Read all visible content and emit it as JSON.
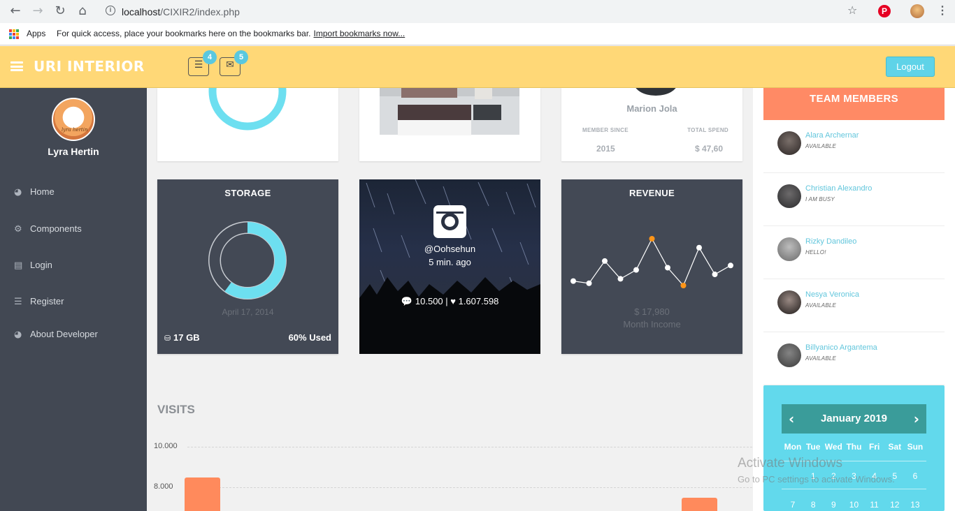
{
  "browser": {
    "url_host": "localhost",
    "url_path": "/CIXIR2/index.php",
    "apps_label": "Apps",
    "bookmarks_hint": "For quick access, place your bookmarks here on the bookmarks bar.",
    "import_link": "Import bookmarks now..."
  },
  "header": {
    "brand": "URI INTERIOR",
    "tasks_badge": "4",
    "mail_badge": "5",
    "logout_label": "Logout"
  },
  "sidebar": {
    "user_name": "Lyra Hertin",
    "avatar_caption": "lyra hertin",
    "items": [
      {
        "label": "Home",
        "icon": "dashboard-icon"
      },
      {
        "label": "Components",
        "icon": "cogs-icon"
      },
      {
        "label": "Login",
        "icon": "book-icon"
      },
      {
        "label": "Register",
        "icon": "list-icon"
      },
      {
        "label": "About Developer",
        "icon": "dashboard-icon"
      }
    ]
  },
  "profile_card": {
    "name": "Marion Jola",
    "member_since_label": "MEMBER SINCE",
    "total_spend_label": "TOTAL SPEND",
    "member_since": "2015",
    "total_spend": "$ 47,60"
  },
  "storage": {
    "title": "STORAGE",
    "date": "April 17, 2014",
    "size": "17 GB",
    "used": "60% Used",
    "used_fraction": 0.6
  },
  "instagram": {
    "handle": "@Oohsehun",
    "time": "5 min. ago",
    "stats": "10.500 | ♥ 1.607.598"
  },
  "revenue": {
    "title": "REVENUE",
    "amount": "$ 17,980",
    "label": "Month Income",
    "sparkline": [
      4,
      3,
      13,
      5,
      9,
      23,
      10,
      2,
      19,
      7,
      11
    ],
    "highlight_indexes": [
      5,
      7
    ]
  },
  "visits": {
    "title": "VISITS",
    "y_ticks": [
      "10.000",
      "8.000"
    ]
  },
  "team": {
    "title": "TEAM MEMBERS",
    "members": [
      {
        "name": "Alara Archernar",
        "status": "AVAILABLE"
      },
      {
        "name": "Christian Alexandro",
        "status": "I AM BUSY"
      },
      {
        "name": "Rizky Dandileo",
        "status": "HELLO!"
      },
      {
        "name": "Nesya Veronica",
        "status": "AVAILABLE"
      },
      {
        "name": "Billyanico Argantema",
        "status": "AVAILABLE"
      }
    ]
  },
  "calendar": {
    "month": "January 2019",
    "days": [
      "Mon",
      "Tue",
      "Wed",
      "Thu",
      "Fri",
      "Sat",
      "Sun"
    ],
    "week1": [
      "",
      "1",
      "2",
      "3",
      "4",
      "5",
      "6"
    ],
    "week2": [
      "7",
      "8",
      "9",
      "10",
      "11",
      "12",
      "13"
    ]
  },
  "watermark": {
    "line1": "Activate Windows",
    "line2": "Go to PC settings to activate Windows."
  },
  "colors": {
    "header": "#ffd877",
    "sidebar": "#424853",
    "accent_cyan": "#5fd3e8",
    "team_header": "#ff8a65",
    "bar_orange": "#ff8a5c"
  }
}
